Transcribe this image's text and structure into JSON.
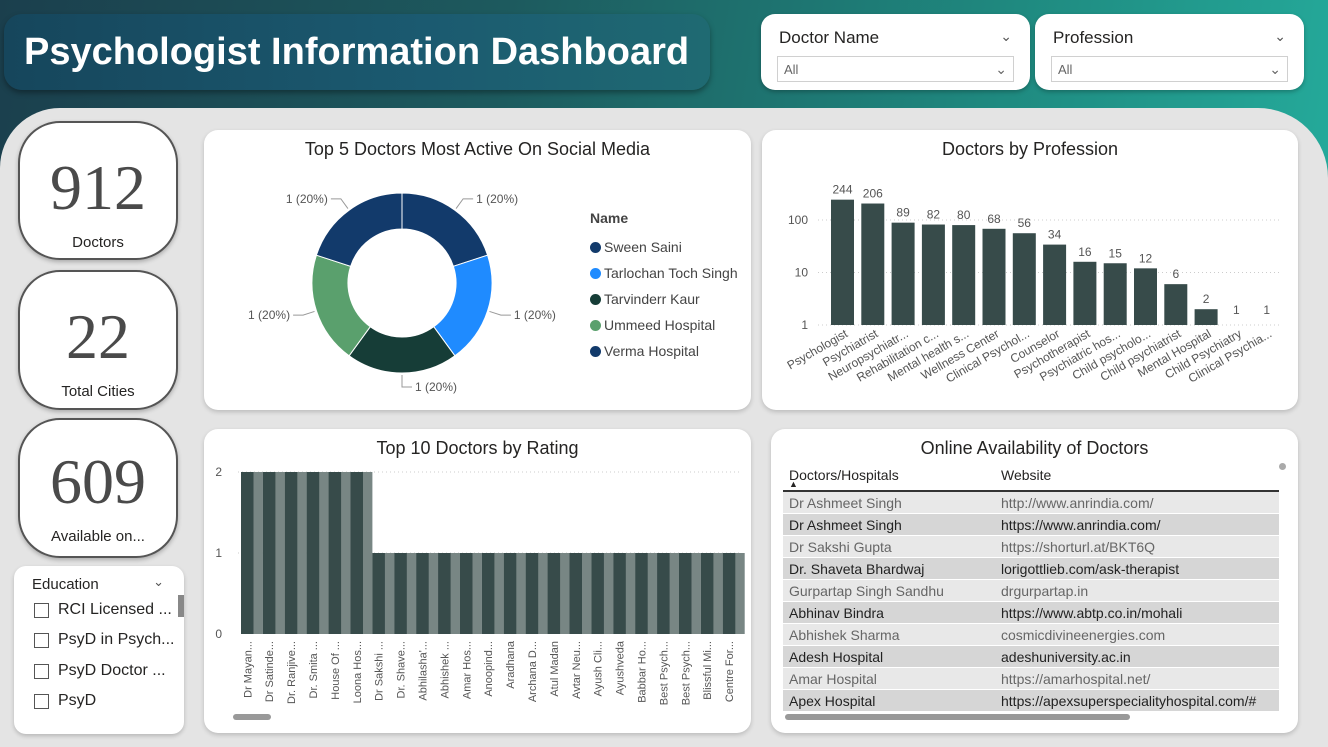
{
  "header": {
    "title": "Psychologist Information Dashboard"
  },
  "filters": {
    "doctor_name": {
      "label": "Doctor Name",
      "value": "All"
    },
    "profession": {
      "label": "Profession",
      "value": "All"
    }
  },
  "kpis": [
    {
      "value": "912",
      "caption": "Doctors"
    },
    {
      "value": "22",
      "caption": "Total Cities"
    },
    {
      "value": "609",
      "caption": "Available on..."
    }
  ],
  "education": {
    "label": "Education",
    "options": [
      "RCI Licensed ...",
      "PsyD in Psych...",
      "PsyD Doctor ...",
      "PsyD"
    ]
  },
  "colors": {
    "bar_dark": "#374b4a",
    "bar_light": "#788684",
    "donut": [
      "#123a6b",
      "#1f8bff",
      "#163d37",
      "#5aa06d",
      "#123a6b"
    ]
  },
  "chart_data": [
    {
      "type": "pie",
      "title": "Top 5 Doctors Most Active On Social Media",
      "legend_title": "Name",
      "legend_position": "right",
      "categories": [
        "Sween Saini",
        "Tarlochan Toch Singh",
        "Tarvinderr Kaur",
        "Ummeed Hospital",
        "Verma Hospital"
      ],
      "values": [
        1,
        1,
        1,
        1,
        1
      ],
      "labels": [
        "1 (20%)",
        "1 (20%)",
        "1 (20%)",
        "1 (20%)",
        "1 (20%)"
      ]
    },
    {
      "type": "bar",
      "title": "Doctors by Profession",
      "yscale": "log",
      "yticks": [
        "1",
        "10",
        "100"
      ],
      "categories": [
        "Psychologist",
        "Psychiatrist",
        "Neuropsychiatr...",
        "Rehabilitation c...",
        "Mental health s...",
        "Wellness Center",
        "Clinical Psychol...",
        "Counselor",
        "Psychotherapist",
        "Psychiatric hos...",
        "Child psycholo...",
        "Child psychiatrist",
        "Mental Hospital",
        "Child Psychiatry",
        "Clinical Psychia..."
      ],
      "values": [
        244,
        206,
        89,
        82,
        80,
        68,
        56,
        34,
        16,
        15,
        12,
        6,
        2,
        1,
        1
      ]
    },
    {
      "type": "area",
      "title": "Top 10 Doctors by Rating",
      "ylim": [
        0,
        2
      ],
      "yticks": [
        "0",
        "1",
        "2"
      ],
      "categories": [
        "Dr Mayan...",
        "Dr Satinde...",
        "Dr. Ranjive...",
        "Dr. Smita ...",
        "House Of ...",
        "Loona Hos...",
        "Dr Sakshi ...",
        "Dr. Shave...",
        "Abhilasha'...",
        "Abhishek ...",
        "Amar Hos...",
        "Anoopind...",
        "Aradhana",
        "Archana D...",
        "Atul Madan",
        "Avtar Neu...",
        "Ayush Cli...",
        "Ayushveda",
        "Babbar Ho...",
        "Best Psych...",
        "Best Psych...",
        "Blissful Mi...",
        "Centre For..."
      ],
      "values": [
        2,
        2,
        2,
        2,
        2,
        2,
        1,
        1,
        1,
        1,
        1,
        1,
        1,
        1,
        1,
        1,
        1,
        1,
        1,
        1,
        1,
        1,
        1
      ]
    }
  ],
  "availability": {
    "title": "Online Availability of Doctors",
    "columns": [
      "Doctors/Hospitals",
      "Website"
    ],
    "sort_indicator": "▲",
    "rows": [
      [
        "Dr Ashmeet Singh",
        "http://www.anrindia.com/"
      ],
      [
        "Dr Ashmeet Singh",
        "https://www.anrindia.com/"
      ],
      [
        "Dr Sakshi Gupta",
        "https://shorturl.at/BKT6Q"
      ],
      [
        "Dr. Shaveta Bhardwaj",
        "lorigottlieb.com/ask-therapist"
      ],
      [
        "Gurpartap Singh Sandhu",
        "drgurpartap.in"
      ],
      [
        "Abhinav Bindra",
        "https://www.abtp.co.in/mohali"
      ],
      [
        "Abhishek Sharma",
        "cosmicdivineenergies.com"
      ],
      [
        "Adesh Hospital",
        "adeshuniversity.ac.in"
      ],
      [
        "Amar Hospital",
        "https://amarhospital.net/"
      ],
      [
        "Apex Hospital",
        "https://apexsuperspecialityhospital.com/#"
      ]
    ]
  }
}
